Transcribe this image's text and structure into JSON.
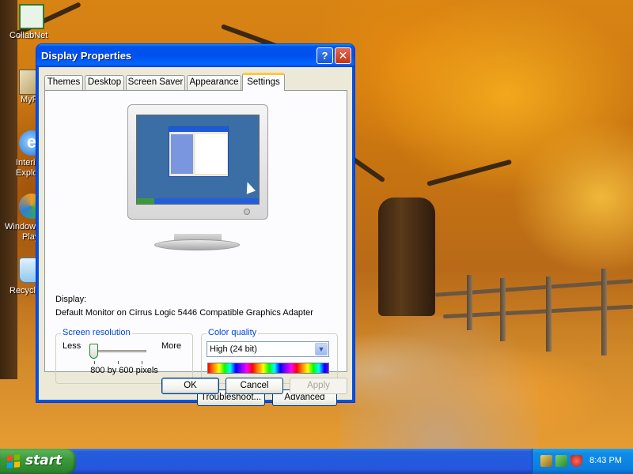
{
  "desktop": {
    "icons": [
      {
        "label": "CollabNet",
        "icon": "collabnet-icon"
      },
      {
        "label": "MyP",
        "icon": "my-pictures-icon"
      },
      {
        "label": "Interi",
        "label2": "Explo",
        "icon": "internet-explorer-icon"
      },
      {
        "label": "Windows",
        "label2": "Play",
        "icon": "windows-media-player-icon"
      },
      {
        "label": "Recycle",
        "icon": "recycle-bin-icon"
      }
    ]
  },
  "window": {
    "title": "Display Properties",
    "help_label": "?",
    "close_label": "✕",
    "tabs": [
      {
        "label": "Themes"
      },
      {
        "label": "Desktop"
      },
      {
        "label": "Screen Saver"
      },
      {
        "label": "Appearance"
      },
      {
        "label": "Settings",
        "active": true
      }
    ],
    "display_label": "Display:",
    "display_value": "Default Monitor on Cirrus Logic 5446 Compatible Graphics Adapter",
    "screen_resolution": {
      "title": "Screen resolution",
      "less_label": "Less",
      "more_label": "More",
      "value": "800 by 600 pixels",
      "slider_level": 0
    },
    "color_quality": {
      "title": "Color quality",
      "selected": "High (24 bit)"
    },
    "buttons": {
      "troubleshoot": "Troubleshoot...",
      "advanced": "Advanced",
      "ok": "OK",
      "cancel": "Cancel",
      "apply": "Apply"
    }
  },
  "taskbar": {
    "start_label": "start",
    "clock": "8:43 PM"
  },
  "colors": {
    "titlebar": "#0053ee",
    "tab_highlight": "#ffc83c",
    "group_title": "#0046d5",
    "taskbar": "#245edb",
    "start_button": "#3c9a3c"
  }
}
